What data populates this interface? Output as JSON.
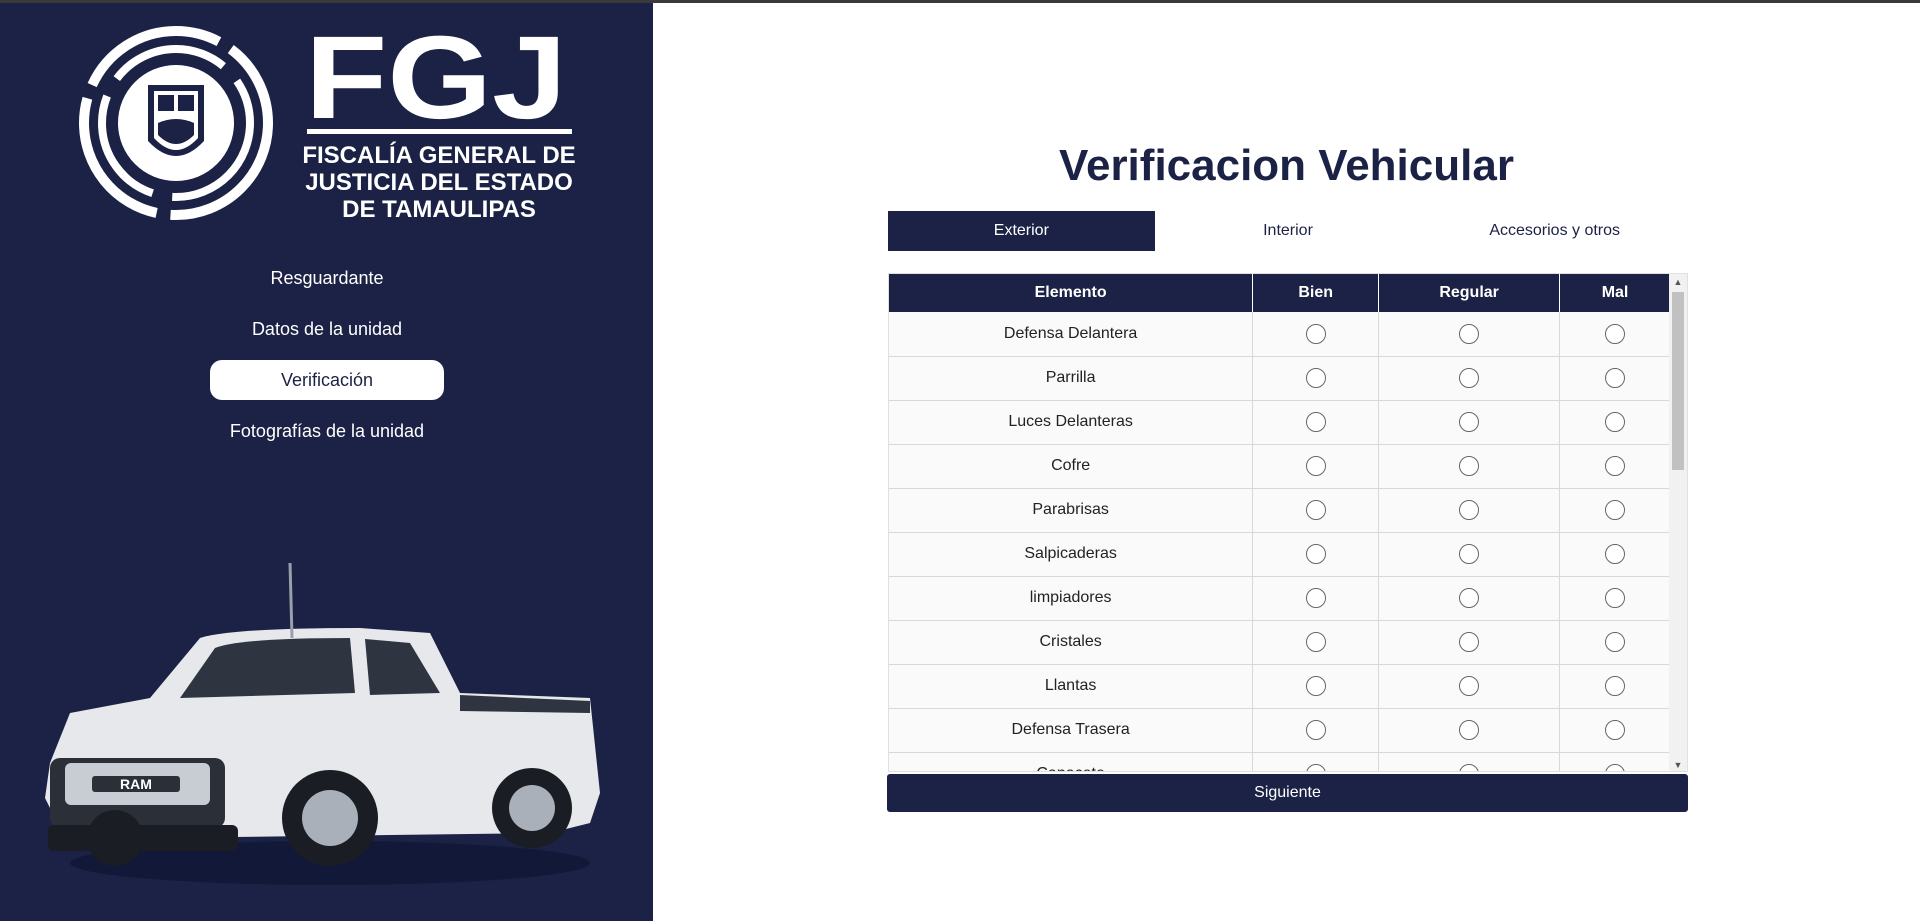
{
  "brand": {
    "logo_text": "FGJ",
    "logo_line1": "FISCALÍA GENERAL DE",
    "logo_line2": "JUSTICIA DEL ESTADO",
    "logo_line3": "DE TAMAULIPAS",
    "truck_badge": "RAM"
  },
  "sidebar": {
    "items": [
      {
        "label": "Resguardante"
      },
      {
        "label": "Datos de la unidad"
      },
      {
        "label": "Verificación"
      },
      {
        "label": "Fotografías de la unidad"
      }
    ],
    "active_index": 2
  },
  "main": {
    "title": "Verificacion Vehicular",
    "tabs": [
      {
        "label": "Exterior"
      },
      {
        "label": "Interior"
      },
      {
        "label": "Accesorios y otros"
      }
    ],
    "active_tab": 0,
    "table": {
      "headers": [
        "Elemento",
        "Bien",
        "Regular",
        "Mal"
      ],
      "rows": [
        "Defensa Delantera",
        "Parrilla",
        "Luces Delanteras",
        "Cofre",
        "Parabrisas",
        "Salpicaderas",
        "limpiadores",
        "Cristales",
        "Llantas",
        "Defensa Trasera",
        "Capacete"
      ]
    },
    "next_label": "Siguiente"
  },
  "colors": {
    "primary": "#1b2245",
    "background": "#ffffff"
  }
}
